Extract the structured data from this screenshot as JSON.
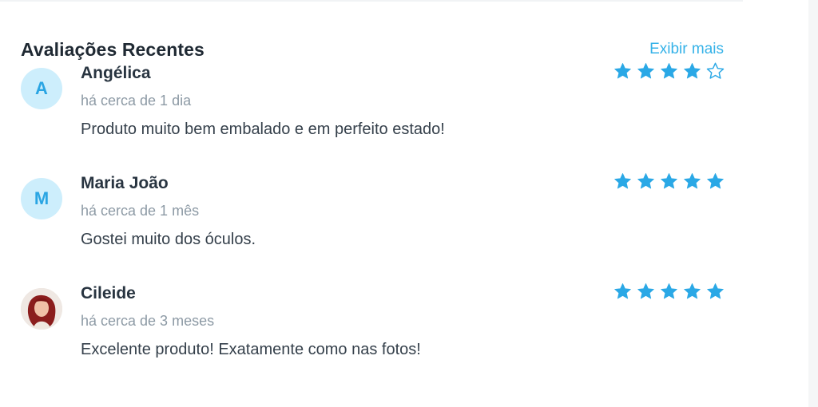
{
  "section": {
    "title": "Avaliações Recentes",
    "show_more_label": "Exibir mais"
  },
  "colors": {
    "accent": "#35b2e8",
    "star": "#2aa8e6",
    "avatar_bg": "#cdeefc",
    "title_text": "#1f2933",
    "muted_text": "#8d9aa5"
  },
  "reviews": [
    {
      "initial": "A",
      "name": "Angélica",
      "time": "há cerca de 1 dia",
      "text": "Produto muito bem embalado e em perfeito estado!",
      "rating": 4,
      "max_rating": 5
    },
    {
      "initial": "M",
      "name": "Maria João",
      "time": "há cerca de 1 mês",
      "text": "Gostei muito dos óculos.",
      "rating": 5,
      "max_rating": 5
    },
    {
      "name": "Cileide",
      "time": "há cerca de 3 meses",
      "text": "Excelente produto! Exatamente como nas fotos!",
      "rating": 5,
      "max_rating": 5,
      "avatar_icon": "user-photo-avatar"
    }
  ]
}
